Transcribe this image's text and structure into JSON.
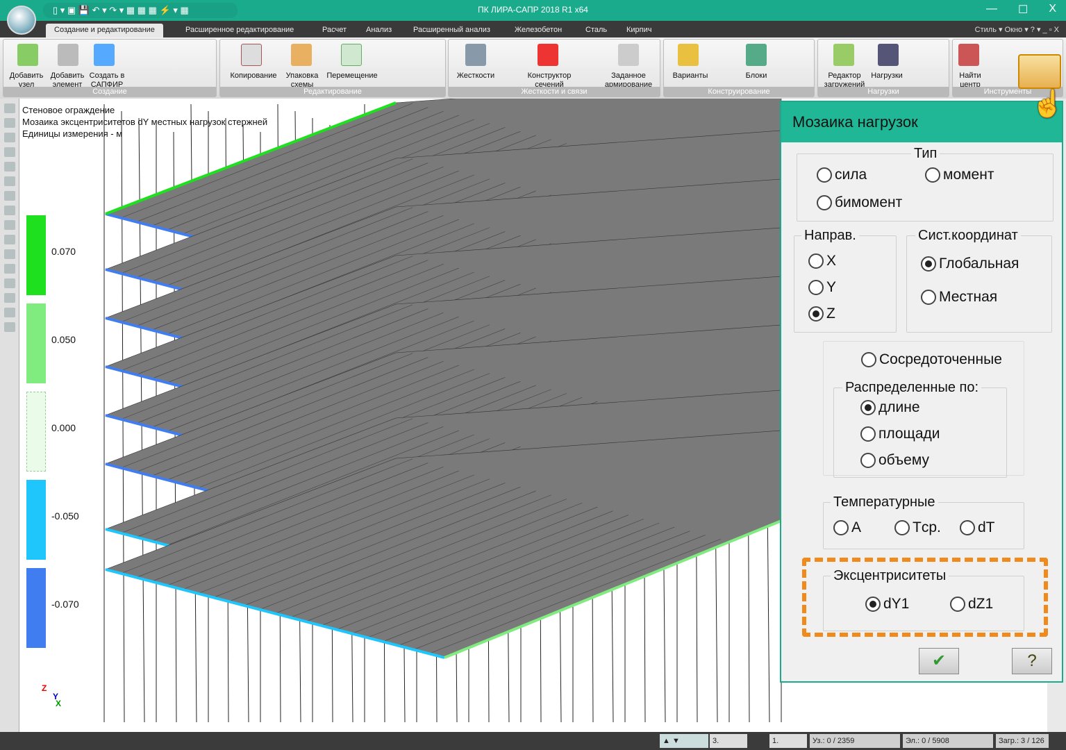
{
  "window": {
    "title": "ПК ЛИРА-САПР  2018 R1 x64",
    "controls": [
      "—",
      "☐",
      "X"
    ]
  },
  "tabs": [
    {
      "label": "Создание и редактирование",
      "active": true
    },
    {
      "label": "Расширенное редактирование"
    },
    {
      "label": "Расчет"
    },
    {
      "label": "Анализ"
    },
    {
      "label": "Расширенный анализ"
    },
    {
      "label": "Железобетон"
    },
    {
      "label": "Сталь"
    },
    {
      "label": "Кирпич"
    }
  ],
  "tab_right": "Стиль ▾ Окно ▾ ? ▾  _ ▫ X",
  "ribbon": {
    "groups": [
      {
        "label": "Создание",
        "buttons": [
          "Добавить узел",
          "Добавить элемент",
          "Создать в САПФИР"
        ]
      },
      {
        "label": "Редактирование",
        "buttons": [
          "Копирование",
          "Упаковка схемы",
          "Перемещение"
        ]
      },
      {
        "label": "Жесткости и связи",
        "buttons": [
          "Жесткости",
          "Конструктор сечений",
          "Заданное армирование"
        ]
      },
      {
        "label": "Конструирование",
        "buttons": [
          "Варианты",
          "Блоки"
        ]
      },
      {
        "label": "Нагрузки",
        "buttons": [
          "Редактор загружений",
          "Нагрузки"
        ]
      },
      {
        "label": "Инструменты",
        "buttons": [
          "Найти центр"
        ]
      }
    ]
  },
  "viewport": {
    "info": [
      "Стеновое ограждение",
      "Мозаика эксцентриситетов dY местных нагрузок стержней",
      "Единицы измерения - м"
    ],
    "legend": [
      {
        "value": "0.070",
        "color": "#1ee01e"
      },
      {
        "value": "0.050",
        "color": "#80ec80"
      },
      {
        "value": "0.000",
        "color": "#eafbea"
      },
      {
        "value": "-0.050",
        "color": "#1ec6fb"
      },
      {
        "value": "-0.070",
        "color": "#3f7df0"
      }
    ],
    "axes": {
      "z": "Z",
      "y": "Y",
      "x": "X"
    }
  },
  "dialog": {
    "title": "Мозаика нагрузок",
    "type": {
      "legend": "Тип",
      "options": [
        {
          "label": "сила",
          "checked": false
        },
        {
          "label": "момент",
          "checked": false
        },
        {
          "label": "бимомент",
          "checked": false
        }
      ]
    },
    "direction": {
      "legend": "Направ.",
      "options": [
        {
          "label": "X",
          "checked": false
        },
        {
          "label": "Y",
          "checked": false
        },
        {
          "label": "Z",
          "checked": true
        }
      ]
    },
    "coords": {
      "legend": "Сист.координат",
      "options": [
        {
          "label": "Глобальная",
          "checked": true
        },
        {
          "label": "Местная",
          "checked": false
        }
      ]
    },
    "concentrated": {
      "label": "Сосредоточенные",
      "checked": false
    },
    "distributed": {
      "legend": "Распределенные по:",
      "options": [
        {
          "label": "длине",
          "checked": true
        },
        {
          "label": "площади",
          "checked": false
        },
        {
          "label": "объему",
          "checked": false
        }
      ]
    },
    "temperature": {
      "legend": "Температурные",
      "options": [
        {
          "label": "A",
          "checked": false
        },
        {
          "label": "Tср.",
          "checked": false
        },
        {
          "label": "dT",
          "checked": false
        }
      ]
    },
    "eccentricity": {
      "legend": "Эксцентриситеты",
      "options": [
        {
          "label": "dY1",
          "checked": true
        },
        {
          "label": "dZ1",
          "checked": false
        }
      ]
    },
    "ok": "✔",
    "help": "?"
  },
  "status": {
    "load_case": "3.",
    "variant": "1.",
    "nodes": "Уз.: 0 / 2359",
    "elements": "Эл.: 0 / 5908",
    "loads": "Загр.: 3 / 126"
  },
  "colors": {
    "accent": "#1aaa8c",
    "highlight": "#f08a1a",
    "slab": "#7a7a7a"
  }
}
